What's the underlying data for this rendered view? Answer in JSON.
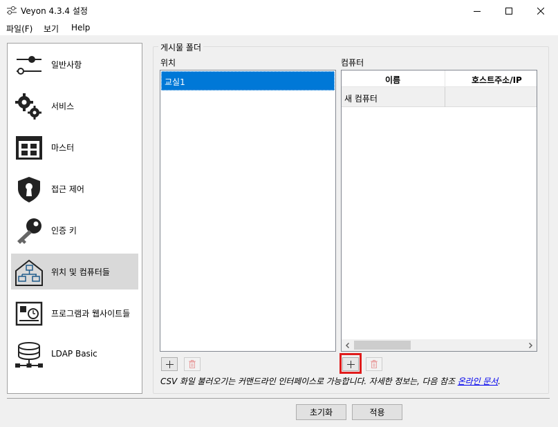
{
  "window": {
    "title": "Veyon  4.3.4 설정",
    "icon": "settings-sliders-icon"
  },
  "menu": {
    "items": [
      "파일(F)",
      "보기",
      "Help"
    ]
  },
  "sidebar": {
    "items": [
      {
        "label": "일반사항",
        "icon": "general-sliders-icon"
      },
      {
        "label": "서비스",
        "icon": "gears-icon"
      },
      {
        "label": "마스터",
        "icon": "master-window-icon"
      },
      {
        "label": "접근 제어",
        "icon": "shield-keyhole-icon"
      },
      {
        "label": "인증 키",
        "icon": "key-icon"
      },
      {
        "label": "위치 및 컴퓨터들",
        "icon": "network-computers-icon",
        "selected": true
      },
      {
        "label": "프로그램과 웹사이트들",
        "icon": "programs-websites-icon"
      },
      {
        "label": "LDAP Basic",
        "icon": "ldap-database-icon"
      }
    ]
  },
  "main": {
    "group_title": "게시물 폴더",
    "locations": {
      "label": "위치",
      "items": [
        "교실1"
      ]
    },
    "computers": {
      "label": "컴퓨터",
      "columns": [
        "이름",
        "호스트주소/IP"
      ],
      "rows": [
        [
          "새 컴퓨터",
          ""
        ]
      ]
    },
    "info": {
      "text": "CSV 화일 불러오기는 커맨드라인 인터페이스로 가능합니다. 자세한 정보는, 다음 참조 ",
      "link": "온라인 문서",
      "suffix": "."
    }
  },
  "footer": {
    "reset_label": "초기화",
    "apply_label": "적용"
  },
  "colors": {
    "selection": "#0078d7",
    "highlight": "#e01b1b",
    "delete_icon": "#e8a0a0"
  }
}
